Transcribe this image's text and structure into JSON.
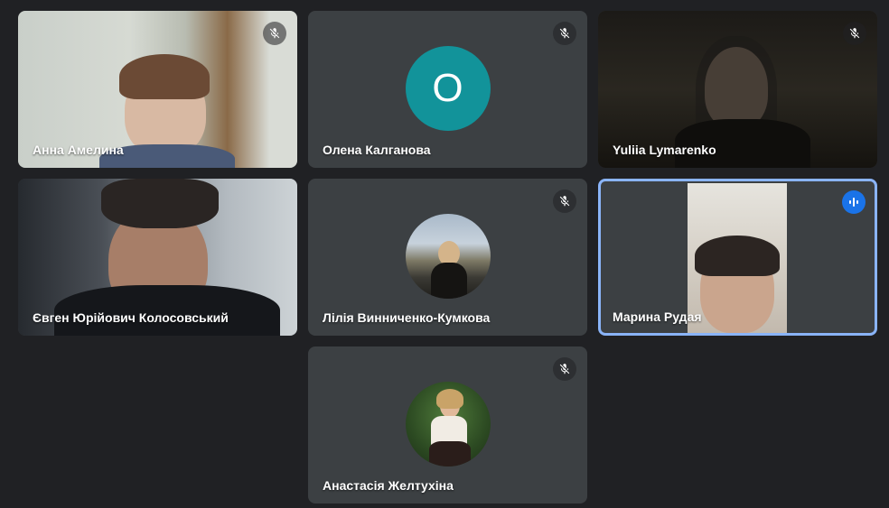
{
  "participants": [
    {
      "name": "Анна Амелина",
      "mic": "muted",
      "display": "video"
    },
    {
      "name": "Олена Калганова",
      "mic": "muted",
      "display": "initial",
      "initial": "O",
      "avatar_color": "#12939a"
    },
    {
      "name": "Yuliia Lymarenko",
      "mic": "muted",
      "display": "video"
    },
    {
      "name": "Євген Юрійович Колосовський",
      "mic": "on",
      "display": "video"
    },
    {
      "name": "Лілія Винниченко-Кумкова",
      "mic": "muted",
      "display": "photo"
    },
    {
      "name": "Марина Рудая",
      "mic": "speaking",
      "display": "video",
      "active_border": "#8ab4f8"
    },
    {
      "name": "Анастасія Желтухіна",
      "mic": "muted",
      "display": "photo"
    }
  ],
  "icons": {
    "muted": "mic-off-icon",
    "speaking": "audio-level-icon"
  },
  "colors": {
    "background": "#202124",
    "tile": "#3c4043",
    "speaking_badge": "#1a73e8"
  }
}
